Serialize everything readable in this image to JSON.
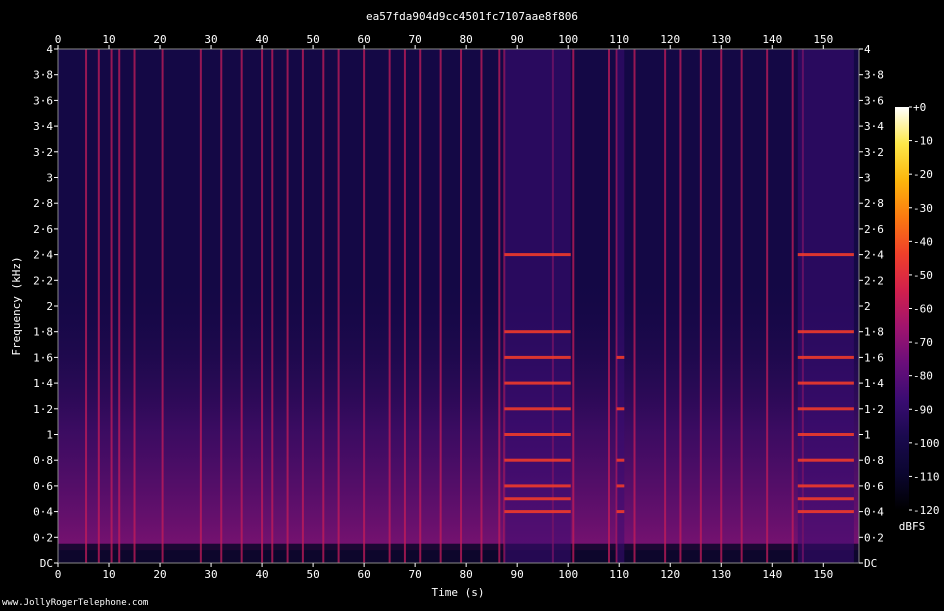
{
  "header": {
    "title": "ea57fda904d9cc4501fc7107aae8f806"
  },
  "footer": {
    "credit": "www.JollyRogerTelephone.com"
  },
  "chart_data": {
    "type": "heatmap",
    "title": "ea57fda904d9cc4501fc7107aae8f806",
    "xlabel": "Time (s)",
    "ylabel": "Frequency (kHz)",
    "xlim": [
      0,
      157
    ],
    "ylim": [
      0,
      4
    ],
    "x_ticks": [
      0,
      10,
      20,
      30,
      40,
      50,
      60,
      70,
      80,
      90,
      100,
      110,
      120,
      130,
      140,
      150
    ],
    "x_tick_labels": [
      "0",
      "10",
      "20",
      "30",
      "40",
      "50",
      "60",
      "70",
      "80",
      "90",
      "100",
      "110",
      "120",
      "130",
      "140",
      "150"
    ],
    "y_ticks": [
      0,
      0.2,
      0.4,
      0.6,
      0.8,
      1,
      1.2,
      1.4,
      1.6,
      1.8,
      2,
      2.2,
      2.4,
      2.6,
      2.8,
      3,
      3.2,
      3.4,
      3.6,
      3.8,
      4
    ],
    "y_tick_labels": [
      "DC",
      "0·2",
      "0·4",
      "0·6",
      "0·8",
      "1",
      "1·2",
      "1·4",
      "1·6",
      "1·8",
      "2",
      "2·2",
      "2·4",
      "2·6",
      "2·8",
      "3",
      "3·2",
      "3·4",
      "3·6",
      "3·8",
      "4"
    ],
    "colorbar": {
      "label": "dBFS",
      "min": -120,
      "max": 0,
      "ticks": [
        0,
        -10,
        -20,
        -30,
        -40,
        -50,
        -60,
        -70,
        -80,
        -90,
        -100,
        -110,
        -120
      ],
      "tick_labels": [
        "+0",
        "-10",
        "-20",
        "-30",
        "-40",
        "-50",
        "-60",
        "-70",
        "-80",
        "-90",
        "-100",
        "-110",
        "-120"
      ]
    },
    "colors": [
      "#000000",
      "#0b0630",
      "#1a0a4e",
      "#3a0c72",
      "#6a0e7a",
      "#a0146e",
      "#d2204c",
      "#f0402a",
      "#fb7a10",
      "#fcb60c",
      "#fde84a",
      "#ffffff"
    ],
    "events_s": [
      5.5,
      8,
      10.5,
      12,
      15,
      20.5,
      28,
      32,
      36,
      40,
      42,
      45,
      48,
      52,
      55,
      60,
      65,
      68,
      71,
      75,
      79,
      83,
      86.5,
      87.5,
      97,
      101,
      108,
      109.5,
      113,
      119,
      122,
      126,
      130,
      134,
      139,
      144,
      146
    ],
    "tonal_segments": [
      {
        "t_start": 87.5,
        "t_end": 100.5,
        "freqs_khz": [
          0.4,
          0.5,
          0.6,
          0.8,
          1.0,
          1.2,
          1.4,
          1.6,
          1.8,
          2.4
        ]
      },
      {
        "t_start": 109.5,
        "t_end": 111.0,
        "freqs_khz": [
          0.4,
          0.6,
          0.8,
          1.2,
          1.6
        ]
      },
      {
        "t_start": 145.0,
        "t_end": 156.0,
        "freqs_khz": [
          0.4,
          0.5,
          0.6,
          0.8,
          1.0,
          1.2,
          1.4,
          1.6,
          1.8,
          2.4
        ]
      }
    ],
    "grid": false
  }
}
